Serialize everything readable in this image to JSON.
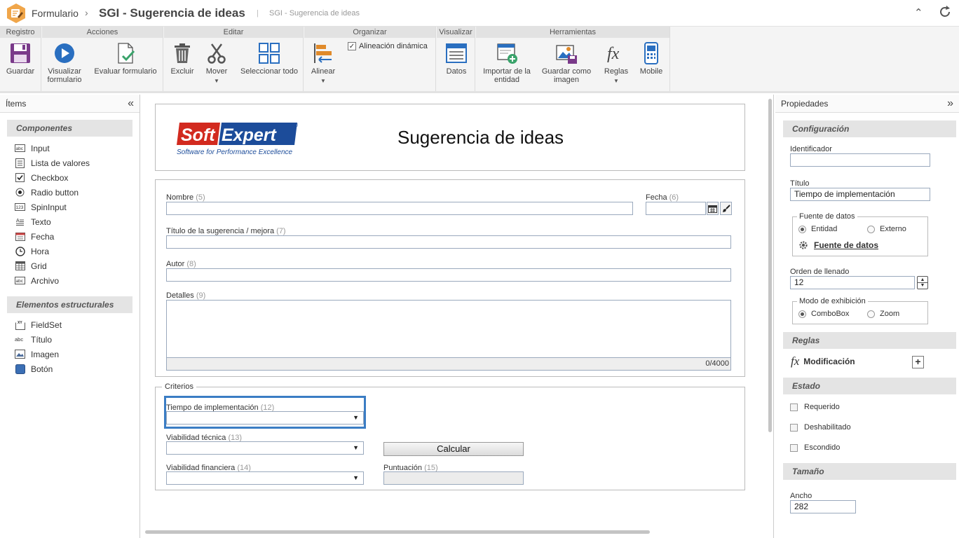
{
  "titlebar": {
    "breadcrumb_root": "Formulario",
    "title": "SGI - Sugerencia de ideas",
    "subtitle": "SGI - Sugerencia de ideas"
  },
  "ribbon": {
    "groups": {
      "registro": "Registro",
      "acciones": "Acciones",
      "editar": "Editar",
      "organizar": "Organizar",
      "visualizar": "Visualizar",
      "herramientas": "Herramientas"
    },
    "buttons": {
      "guardar": "Guardar",
      "visualizar_formulario": [
        "Visualizar",
        "formulario"
      ],
      "evaluar_formulario": "Evaluar formulario",
      "excluir": "Excluir",
      "mover": "Mover",
      "seleccionar_todo": "Seleccionar todo",
      "alinear": "Alinear",
      "alineacion_dinamica": "Alineación dinámica",
      "datos": "Datos",
      "importar_entidad": [
        "Importar de la",
        "entidad"
      ],
      "guardar_imagen": [
        "Guardar como",
        "imagen"
      ],
      "reglas": "Reglas",
      "mobile": "Mobile"
    },
    "alineacion_dinamica_checked": true
  },
  "items_panel": {
    "title": "Ítems",
    "components_header": "Componentes",
    "components": [
      {
        "label": "Input",
        "icon": "input-icon"
      },
      {
        "label": "Lista de valores",
        "icon": "list-icon"
      },
      {
        "label": "Checkbox",
        "icon": "checkbox-icon"
      },
      {
        "label": "Radio button",
        "icon": "radio-icon"
      },
      {
        "label": "SpinInput",
        "icon": "spin-icon"
      },
      {
        "label": "Texto",
        "icon": "text-icon"
      },
      {
        "label": "Fecha",
        "icon": "calendar-icon"
      },
      {
        "label": "Hora",
        "icon": "clock-icon"
      },
      {
        "label": "Grid",
        "icon": "grid-icon"
      },
      {
        "label": "Archivo",
        "icon": "file-icon"
      }
    ],
    "structural_header": "Elementos estructurales",
    "structural": [
      {
        "label": "FieldSet",
        "icon": "fieldset-icon"
      },
      {
        "label": "Título",
        "icon": "title-icon"
      },
      {
        "label": "Imagen",
        "icon": "image-icon"
      },
      {
        "label": "Botón",
        "icon": "button-icon"
      }
    ]
  },
  "form": {
    "logo": {
      "soft": "Soft",
      "expert": "Expert",
      "tagline": "Software for Performance Excellence",
      "reg": "®"
    },
    "heading": "Sugerencia de ideas",
    "nombre": {
      "label": "Nombre",
      "num": "(5)"
    },
    "fecha": {
      "label": "Fecha",
      "num": "(6)"
    },
    "titulo_sugerencia": {
      "label": "Título de la sugerencia / mejora",
      "num": "(7)"
    },
    "autor": {
      "label": "Autor",
      "num": "(8)"
    },
    "detalles": {
      "label": "Detalles",
      "num": "(9)",
      "counter": "0/4000"
    },
    "criterios_legend": "Criterios",
    "tiempo": {
      "label": "Tiempo de implementación",
      "num": "(12)"
    },
    "viabilidad_tecnica": {
      "label": "Viabilidad técnica",
      "num": "(13)"
    },
    "calcular": "Calcular",
    "viabilidad_financiera": {
      "label": "Viabilidad financiera",
      "num": "(14)"
    },
    "puntuacion": {
      "label": "Puntuación",
      "num": "(15)"
    }
  },
  "properties": {
    "title": "Propiedades",
    "configuracion": "Configuración",
    "identificador_label": "Identificador",
    "identificador_value": "",
    "titulo_label": "Título",
    "titulo_value": "Tiempo de implementación",
    "fuente_legend": "Fuente de datos",
    "fuente_entidad": "Entidad",
    "fuente_externo": "Externo",
    "fuente_link": "Fuente de datos",
    "orden_label": "Orden de llenado",
    "orden_value": "12",
    "modo_legend": "Modo de exhibición",
    "modo_combobox": "ComboBox",
    "modo_zoom": "Zoom",
    "reglas": "Reglas",
    "modificacion": "Modificación",
    "estado": "Estado",
    "requerido": "Requerido",
    "deshabilitado": "Deshabilitado",
    "escondido": "Escondido",
    "tamano": "Tamaño",
    "ancho_label": "Ancho",
    "ancho_value": "282"
  }
}
